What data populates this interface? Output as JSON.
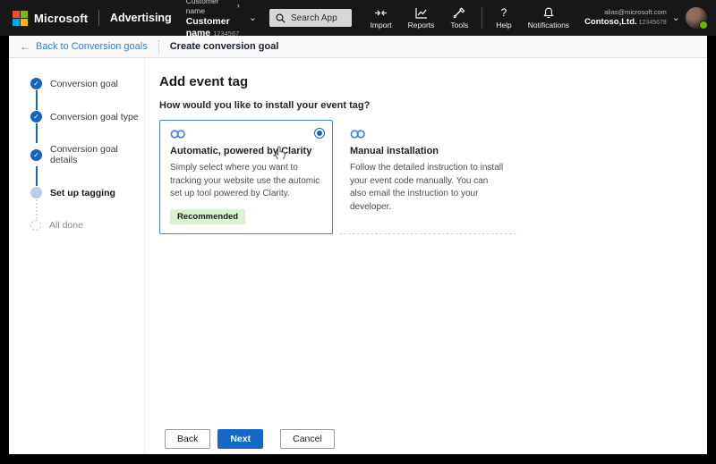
{
  "topbar": {
    "brand": "Microsoft",
    "product": "Advertising",
    "account_picker": {
      "parent_name": "Customer name",
      "current_name": "Customer name",
      "current_id": "1234567"
    },
    "search": {
      "placeholder": "Search App"
    },
    "menu": [
      {
        "label": "Import"
      },
      {
        "label": "Reports"
      },
      {
        "label": "Tools"
      },
      {
        "label": "Help"
      },
      {
        "label": "Notifications"
      }
    ],
    "profile": {
      "email": "alias@microsoft.com",
      "company": "Contoso,Ltd.",
      "company_id": "12345678"
    }
  },
  "subheader": {
    "back_link": "Back to Conversion goals",
    "title": "Create conversion goal"
  },
  "wizard": {
    "steps": [
      {
        "label": "Conversion goal",
        "state": "done"
      },
      {
        "label": "Conversion goal type",
        "state": "done"
      },
      {
        "label": "Conversion goal details",
        "state": "done"
      },
      {
        "label": "Set up tagging",
        "state": "current"
      },
      {
        "label": "All done",
        "state": "upcoming"
      }
    ]
  },
  "main": {
    "heading": "Add event tag",
    "question": "How would you like to install your event tag?",
    "options": [
      {
        "title": "Automatic, powered by Clarity",
        "description": "Simply select where you want to tracking your website use the automic set up tool powered by Clarity.",
        "badge": "Recommended",
        "selected": true
      },
      {
        "title": "Manual installation",
        "description": "Follow the detailed instruction to install your event code manually. You can also email the instruction to your developer.",
        "selected": false
      }
    ],
    "buttons": {
      "back": "Back",
      "next": "Next",
      "cancel": "Cancel"
    }
  },
  "icons": {
    "back_arrow": "←",
    "chevron_right": "›",
    "chevron_down": "⌄",
    "help_glyph": "?",
    "check": "✓"
  },
  "colors": {
    "topbar_bg": "#171717",
    "accent_blue": "#1565c0",
    "primary_button": "#1568c8",
    "link_blue": "#2e7fd0",
    "badge_green_bg": "#d9f2d2",
    "selected_card_border": "#4388d8",
    "logo_red": "#f25022",
    "logo_green": "#7fba00",
    "logo_blue": "#00a4ef",
    "logo_yellow": "#ffb900",
    "presence_green": "#6bb700"
  }
}
